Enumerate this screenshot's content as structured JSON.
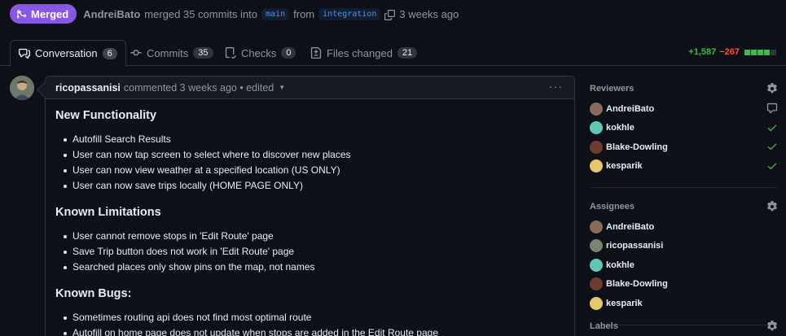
{
  "header": {
    "badge": "Merged",
    "author": "AndreiBato",
    "text_merged": "merged 35 commits into",
    "base_branch": "main",
    "text_from": "from",
    "head_branch": "integration",
    "time": "3 weeks ago"
  },
  "tabs": [
    {
      "label": "Conversation",
      "count": "6",
      "icon": "conversation-icon"
    },
    {
      "label": "Commits",
      "count": "35",
      "icon": "commit-icon"
    },
    {
      "label": "Checks",
      "count": "0",
      "icon": "checks-icon"
    },
    {
      "label": "Files changed",
      "count": "21",
      "icon": "file-diff-icon"
    }
  ],
  "diffstat": {
    "additions": "+1,587",
    "deletions": "−267",
    "blocks": 5,
    "green_blocks": 4
  },
  "comment": {
    "author": "ricopassanisi",
    "meta": "commented 3 weeks ago • edited",
    "sections": [
      {
        "heading": "New Functionality",
        "items": [
          "Autofill Search Results",
          "User can now tap screen to select where to discover new places",
          "User can now view weather at a specified location (US ONLY)",
          "User can now save trips locally (HOME PAGE ONLY)"
        ]
      },
      {
        "heading": "Known Limitations",
        "items": [
          "User cannot remove stops in 'Edit Route' page",
          "Save Trip button does not work in 'Edit Route' page",
          "Searched places only show pins on the map, not names"
        ]
      },
      {
        "heading": "Known Bugs:",
        "items": [
          "Sometimes routing api does not find most optimal route",
          "Autofill on home page does not update when stops are added in the Edit Route page"
        ]
      }
    ]
  },
  "sidebar": {
    "reviewers": {
      "title": "Reviewers",
      "people": [
        {
          "name": "AndreiBato",
          "status": "comment-icon",
          "avatar_color": "#8a6a5c"
        },
        {
          "name": "kokhle",
          "status": "check-icon",
          "avatar_color": "#5fc9b4"
        },
        {
          "name": "Blake-Dowling",
          "status": "check-icon",
          "avatar_color": "#6e3b2f"
        },
        {
          "name": "kesparik",
          "status": "check-icon",
          "avatar_color": "#e6c86a"
        }
      ]
    },
    "assignees": {
      "title": "Assignees",
      "people": [
        {
          "name": "AndreiBato",
          "avatar_color": "#8a6a5c"
        },
        {
          "name": "ricopassanisi",
          "avatar_color": "#7a8470"
        },
        {
          "name": "kokhle",
          "avatar_color": "#5fc9b4"
        },
        {
          "name": "Blake-Dowling",
          "avatar_color": "#6e3b2f"
        },
        {
          "name": "kesparik",
          "avatar_color": "#e6c86a"
        }
      ]
    },
    "labels": {
      "title": "Labels"
    }
  },
  "colors": {
    "merged": "#8957e5",
    "addition": "#3fb950",
    "deletion": "#f85149",
    "link": "#4493f8"
  }
}
